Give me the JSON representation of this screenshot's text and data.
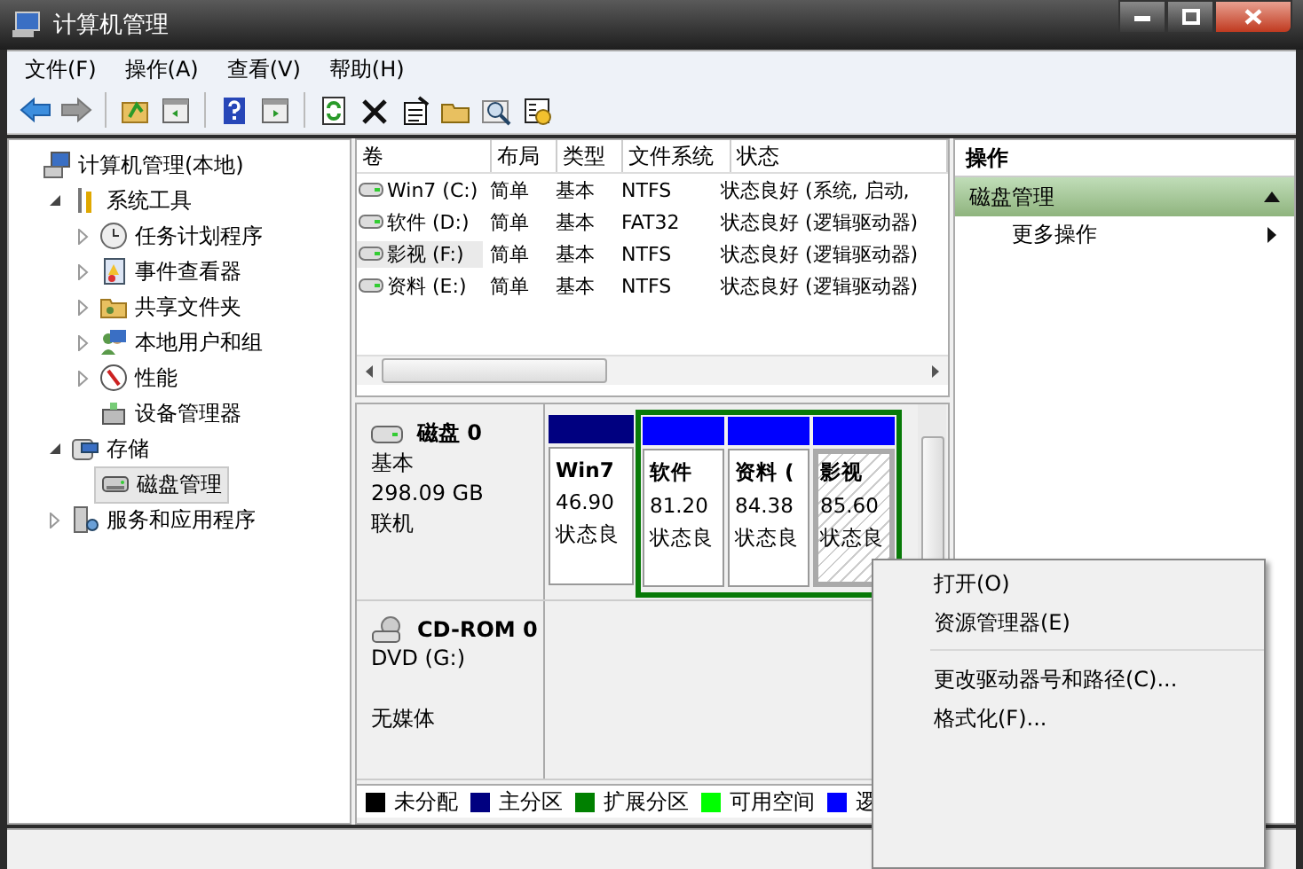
{
  "window": {
    "title": "计算机管理"
  },
  "menu": [
    "文件(F)",
    "操作(A)",
    "查看(V)",
    "帮助(H)"
  ],
  "tree": [
    {
      "label": "计算机管理(本地)",
      "selected": false,
      "children": [
        {
          "label": "系统工具",
          "selected": false,
          "expanded": true,
          "children": [
            {
              "label": "任务计划程序",
              "selected": false,
              "expanded": false
            },
            {
              "label": "事件查看器",
              "selected": false,
              "expanded": false
            },
            {
              "label": "共享文件夹",
              "selected": false,
              "expanded": false
            },
            {
              "label": "本地用户和组",
              "selected": false,
              "expanded": false
            },
            {
              "label": "性能",
              "selected": false,
              "expanded": false
            },
            {
              "label": "设备管理器",
              "selected": false
            }
          ]
        },
        {
          "label": "存储",
          "selected": false,
          "expanded": true,
          "children": [
            {
              "label": "磁盘管理",
              "selected": true
            }
          ]
        },
        {
          "label": "服务和应用程序",
          "selected": false,
          "expanded": false
        }
      ]
    }
  ],
  "volumes": {
    "columns": [
      "卷",
      "布局",
      "类型",
      "文件系统",
      "状态"
    ],
    "rows": [
      {
        "cells": [
          "Win7 (C:)",
          "简单",
          "基本",
          "NTFS",
          "状态良好 (系统, 启动,"
        ],
        "selected": false
      },
      {
        "cells": [
          "软件 (D:)",
          "简单",
          "基本",
          "FAT32",
          "状态良好 (逻辑驱动器)"
        ],
        "selected": false
      },
      {
        "cells": [
          "影视 (F:)",
          "简单",
          "基本",
          "NTFS",
          "状态良好 (逻辑驱动器)"
        ],
        "selected": true
      },
      {
        "cells": [
          "资料 (E:)",
          "简单",
          "基本",
          "NTFS",
          "状态良好 (逻辑驱动器)"
        ],
        "selected": false
      }
    ]
  },
  "disks": [
    {
      "kind": "disk",
      "name": "磁盘 0",
      "lines": [
        "基本",
        "298.09 GB",
        "联机"
      ],
      "partitions": [
        {
          "kind": "primary",
          "name": "Win7",
          "size": "46.90",
          "status": "状态良",
          "selected": false
        },
        {
          "kind": "logical",
          "name": "软件",
          "size": "81.20",
          "status": "状态良",
          "selected": false
        },
        {
          "kind": "logical",
          "name": "资料 (",
          "size": "84.38",
          "status": "状态良",
          "selected": false
        },
        {
          "kind": "logical",
          "name": "影视",
          "size": "85.60",
          "status": "状态良",
          "selected": true
        }
      ]
    },
    {
      "kind": "cdrom",
      "name": "CD-ROM 0",
      "lines": [
        "DVD (G:)",
        "无媒体"
      ]
    }
  ],
  "legend": [
    {
      "label": "未分配",
      "color": "#000000"
    },
    {
      "label": "主分区",
      "color": "#000080"
    },
    {
      "label": "扩展分区",
      "color": "#008000"
    },
    {
      "label": "可用空间",
      "color": "#00ff00"
    },
    {
      "label": "逻",
      "color": "#0000ff"
    }
  ],
  "actions": {
    "header": "操作",
    "sections": [
      {
        "title": "磁盘管理",
        "expanded": true,
        "items": [
          "更多操作"
        ]
      }
    ]
  },
  "context_menu": [
    {
      "kind": "item",
      "label": "打开(O)"
    },
    {
      "kind": "item",
      "label": "资源管理器(E)"
    },
    {
      "kind": "separator"
    },
    {
      "kind": "item",
      "label": "更改驱动器号和路径(C)..."
    },
    {
      "kind": "item",
      "label": "格式化(F)..."
    }
  ]
}
